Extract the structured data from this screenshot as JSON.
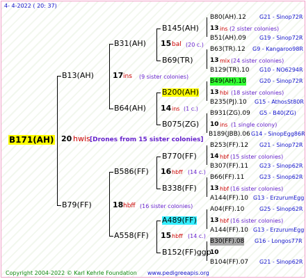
{
  "header": {
    "date": "4-  4-2022 ( 20: 37)"
  },
  "root": {
    "label": "B171(AH)",
    "gen": "20",
    "name": "hwis",
    "note": "[Drones from 15 sister colonies]"
  },
  "gen1": [
    {
      "label": "B13(AH)",
      "gen": "17",
      "name": "ins",
      "note": "(9 sister colonies)"
    },
    {
      "label": "B79(FF)",
      "gen": "18",
      "name": "hbff",
      "note": "(16 sister colonies)"
    }
  ],
  "gen2": [
    {
      "label": "B31(AH)",
      "gen": "15",
      "name": "bal",
      "note": "(20 c.)"
    },
    {
      "label": "B64(AH)",
      "gen": "14",
      "name": "ins",
      "note": "(1 c.)"
    },
    {
      "label": "B586(FF)",
      "gen": "16",
      "name": "hbff",
      "note": "(14 c.)"
    },
    {
      "label": "A558(FF)",
      "gen": "15",
      "name": "hbff",
      "note": "(14 c.)"
    }
  ],
  "gen3": [
    {
      "label": "B145(AH)",
      "gen": "13",
      "name": "ins",
      "note": "(2 sister colonies)",
      "top": "B80(AH).12",
      "top_line": "G21 - Sinop72R",
      "bottom": "B51(AH).09",
      "bottom_line": "G19 - Sinop72R"
    },
    {
      "label": "B69(TR)",
      "gen": "13",
      "name": "mix",
      "note": "(24 sister colonies)",
      "top": "B63(TR).12",
      "top_line": "G9 - Kangaroo98R",
      "bottom": "B129(TR).10",
      "bottom_line": "G10 - NO6294R"
    },
    {
      "label": "B200(AH)",
      "gen": "13",
      "name": "hbi",
      "note": "(18 sister colonies)",
      "top": "B49(AH).10",
      "top_line": "G20 - Sinop72R",
      "bottom": "B235(PJ).10",
      "bottom_line": "G15 - AthosSt80R"
    },
    {
      "label": "B075(ZG)",
      "gen": "10",
      "name": "ins",
      "note": "(1 single colony)",
      "top": "B931(ZG).09",
      "top_line": "G5 - B40(ZG)",
      "bottom": "B189(JBB).06",
      "bottom_line": "G14 - SinopEgg86R"
    },
    {
      "label": "B770(FF)",
      "gen": "14",
      "name": "hbf",
      "note": "(15 sister colonies)",
      "top": "B253(FF).12",
      "top_line": "G21 - Sinop72R",
      "bottom": "B307(FF).11",
      "bottom_line": "G23 - Sinop62R"
    },
    {
      "label": "B338(FF)",
      "gen": "13",
      "name": "hbf",
      "note": "(16 sister colonies)",
      "top": "B66(FF).11",
      "top_line": "G23 - Sinop62R",
      "bottom": "A144(FF).10",
      "bottom_line": "G13 - ErzurumEgg8"
    },
    {
      "label": "A489(FF)",
      "gen": "13",
      "name": "hbf",
      "note": "(16 sister colonies)",
      "top": "A04(FF).10",
      "top_line": "G25 - Sinop62R",
      "bottom": "A144(FF).10",
      "bottom_line": "G13 - ErzurumEgg8"
    },
    {
      "label": "B152(FF)ggp",
      "gen": "10",
      "name": "",
      "note": "",
      "top": "B30(FF).08",
      "top_line": "G16 - Longos77R",
      "bottom": "B104(FF).07",
      "bottom_line": "G21 - Sinop62R"
    }
  ],
  "footer": {
    "copyright": "Copyright 2004-2022 © Karl Kehrle Foundation",
    "site": "www.pedigreeapis.org"
  }
}
